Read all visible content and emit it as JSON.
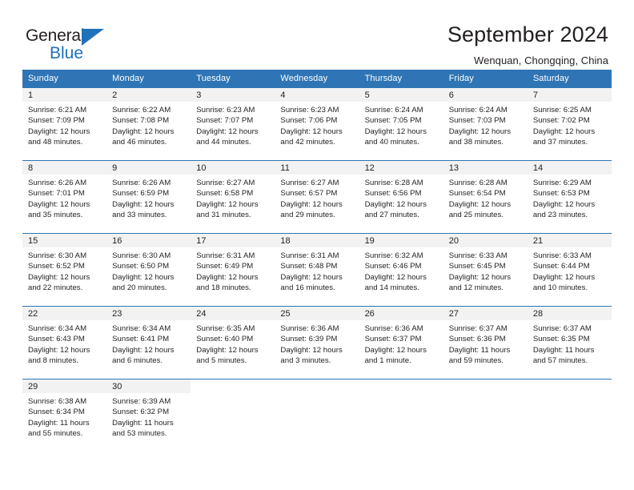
{
  "brand": {
    "name_top": "General",
    "name_bottom": "Blue",
    "flag_icon": "blue-triangle-flag-icon",
    "accent_color": "#1f72b8"
  },
  "header": {
    "title": "September 2024",
    "subtitle": "Wenquan, Chongqing, China"
  },
  "calendar": {
    "header_bg": "#2f75b5",
    "daynum_bg": "#f2f2f2",
    "weekday_headers": [
      "Sunday",
      "Monday",
      "Tuesday",
      "Wednesday",
      "Thursday",
      "Friday",
      "Saturday"
    ],
    "weeks": [
      [
        {
          "day": "1",
          "info": "Sunrise: 6:21 AM\nSunset: 7:09 PM\nDaylight: 12 hours\nand 48 minutes."
        },
        {
          "day": "2",
          "info": "Sunrise: 6:22 AM\nSunset: 7:08 PM\nDaylight: 12 hours\nand 46 minutes."
        },
        {
          "day": "3",
          "info": "Sunrise: 6:23 AM\nSunset: 7:07 PM\nDaylight: 12 hours\nand 44 minutes."
        },
        {
          "day": "4",
          "info": "Sunrise: 6:23 AM\nSunset: 7:06 PM\nDaylight: 12 hours\nand 42 minutes."
        },
        {
          "day": "5",
          "info": "Sunrise: 6:24 AM\nSunset: 7:05 PM\nDaylight: 12 hours\nand 40 minutes."
        },
        {
          "day": "6",
          "info": "Sunrise: 6:24 AM\nSunset: 7:03 PM\nDaylight: 12 hours\nand 38 minutes."
        },
        {
          "day": "7",
          "info": "Sunrise: 6:25 AM\nSunset: 7:02 PM\nDaylight: 12 hours\nand 37 minutes."
        }
      ],
      [
        {
          "day": "8",
          "info": "Sunrise: 6:26 AM\nSunset: 7:01 PM\nDaylight: 12 hours\nand 35 minutes."
        },
        {
          "day": "9",
          "info": "Sunrise: 6:26 AM\nSunset: 6:59 PM\nDaylight: 12 hours\nand 33 minutes."
        },
        {
          "day": "10",
          "info": "Sunrise: 6:27 AM\nSunset: 6:58 PM\nDaylight: 12 hours\nand 31 minutes."
        },
        {
          "day": "11",
          "info": "Sunrise: 6:27 AM\nSunset: 6:57 PM\nDaylight: 12 hours\nand 29 minutes."
        },
        {
          "day": "12",
          "info": "Sunrise: 6:28 AM\nSunset: 6:56 PM\nDaylight: 12 hours\nand 27 minutes."
        },
        {
          "day": "13",
          "info": "Sunrise: 6:28 AM\nSunset: 6:54 PM\nDaylight: 12 hours\nand 25 minutes."
        },
        {
          "day": "14",
          "info": "Sunrise: 6:29 AM\nSunset: 6:53 PM\nDaylight: 12 hours\nand 23 minutes."
        }
      ],
      [
        {
          "day": "15",
          "info": "Sunrise: 6:30 AM\nSunset: 6:52 PM\nDaylight: 12 hours\nand 22 minutes."
        },
        {
          "day": "16",
          "info": "Sunrise: 6:30 AM\nSunset: 6:50 PM\nDaylight: 12 hours\nand 20 minutes."
        },
        {
          "day": "17",
          "info": "Sunrise: 6:31 AM\nSunset: 6:49 PM\nDaylight: 12 hours\nand 18 minutes."
        },
        {
          "day": "18",
          "info": "Sunrise: 6:31 AM\nSunset: 6:48 PM\nDaylight: 12 hours\nand 16 minutes."
        },
        {
          "day": "19",
          "info": "Sunrise: 6:32 AM\nSunset: 6:46 PM\nDaylight: 12 hours\nand 14 minutes."
        },
        {
          "day": "20",
          "info": "Sunrise: 6:33 AM\nSunset: 6:45 PM\nDaylight: 12 hours\nand 12 minutes."
        },
        {
          "day": "21",
          "info": "Sunrise: 6:33 AM\nSunset: 6:44 PM\nDaylight: 12 hours\nand 10 minutes."
        }
      ],
      [
        {
          "day": "22",
          "info": "Sunrise: 6:34 AM\nSunset: 6:43 PM\nDaylight: 12 hours\nand 8 minutes."
        },
        {
          "day": "23",
          "info": "Sunrise: 6:34 AM\nSunset: 6:41 PM\nDaylight: 12 hours\nand 6 minutes."
        },
        {
          "day": "24",
          "info": "Sunrise: 6:35 AM\nSunset: 6:40 PM\nDaylight: 12 hours\nand 5 minutes."
        },
        {
          "day": "25",
          "info": "Sunrise: 6:36 AM\nSunset: 6:39 PM\nDaylight: 12 hours\nand 3 minutes."
        },
        {
          "day": "26",
          "info": "Sunrise: 6:36 AM\nSunset: 6:37 PM\nDaylight: 12 hours\nand 1 minute."
        },
        {
          "day": "27",
          "info": "Sunrise: 6:37 AM\nSunset: 6:36 PM\nDaylight: 11 hours\nand 59 minutes."
        },
        {
          "day": "28",
          "info": "Sunrise: 6:37 AM\nSunset: 6:35 PM\nDaylight: 11 hours\nand 57 minutes."
        }
      ],
      [
        {
          "day": "29",
          "info": "Sunrise: 6:38 AM\nSunset: 6:34 PM\nDaylight: 11 hours\nand 55 minutes."
        },
        {
          "day": "30",
          "info": "Sunrise: 6:39 AM\nSunset: 6:32 PM\nDaylight: 11 hours\nand 53 minutes."
        },
        {
          "day": "",
          "info": ""
        },
        {
          "day": "",
          "info": ""
        },
        {
          "day": "",
          "info": ""
        },
        {
          "day": "",
          "info": ""
        },
        {
          "day": "",
          "info": ""
        }
      ]
    ]
  }
}
